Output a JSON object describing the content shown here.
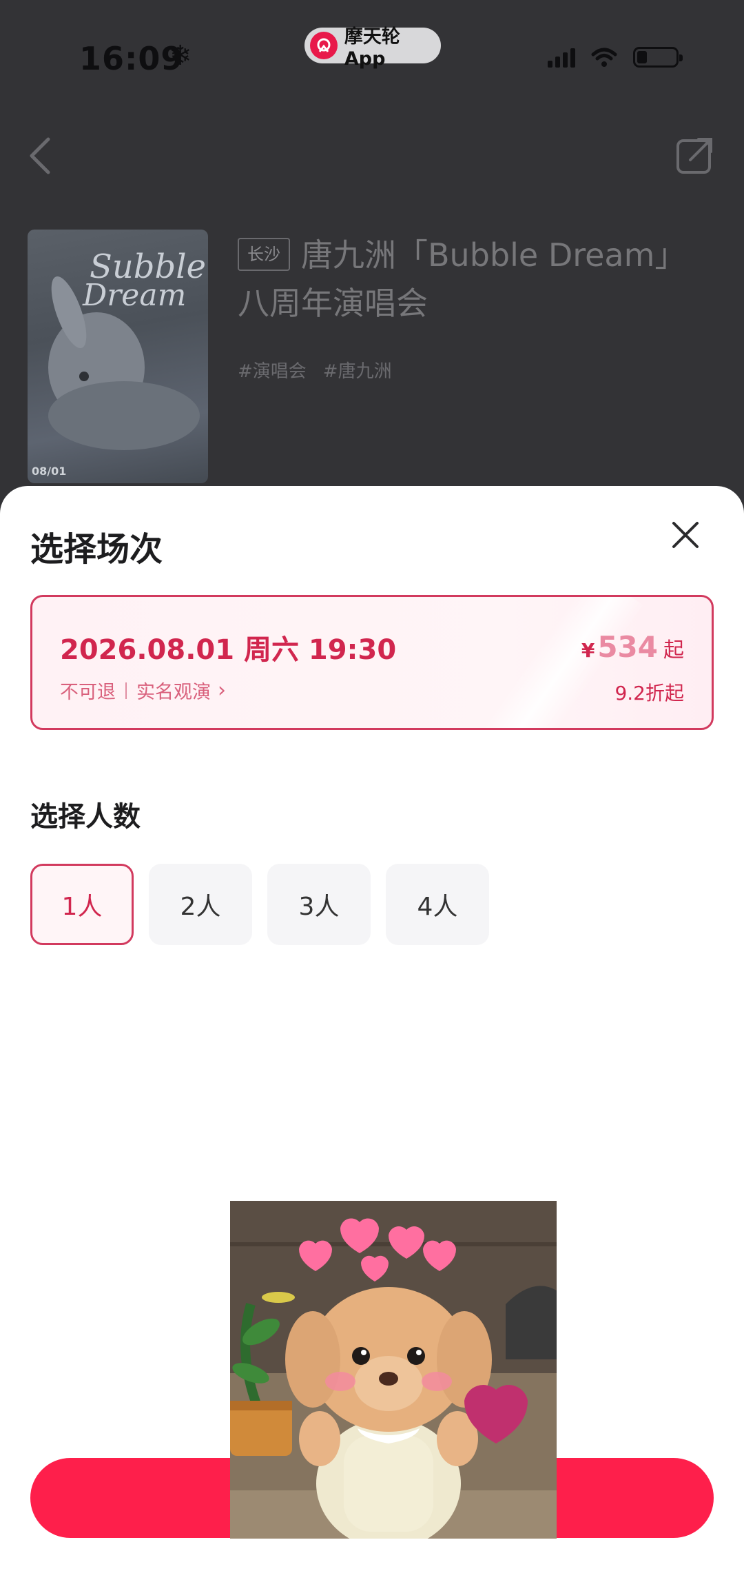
{
  "status_bar": {
    "time": "16:09",
    "app_pill": "摩天轮App"
  },
  "event": {
    "city_tag": "长沙",
    "title_line1": "唐九洲「Bubble Dream」",
    "title_line2": "八周年演唱会",
    "hashtags": [
      "#演唱会",
      "#唐九洲"
    ],
    "poster_date": "08/01"
  },
  "sheet": {
    "title": "选择场次",
    "session": {
      "datetime": "2026.08.01 周六 19:30",
      "refund": "不可退",
      "realname": "实名观演",
      "currency": "¥",
      "price": "534",
      "price_suffix": "起",
      "discount": "9.2折起"
    },
    "count_title": "选择人数",
    "count_options": [
      "1人",
      "2人",
      "3人",
      "4人"
    ],
    "selected_count": "1人"
  },
  "colors": {
    "accent": "#d1264e",
    "button": "#fe1f4b",
    "overlay": "#333336"
  }
}
